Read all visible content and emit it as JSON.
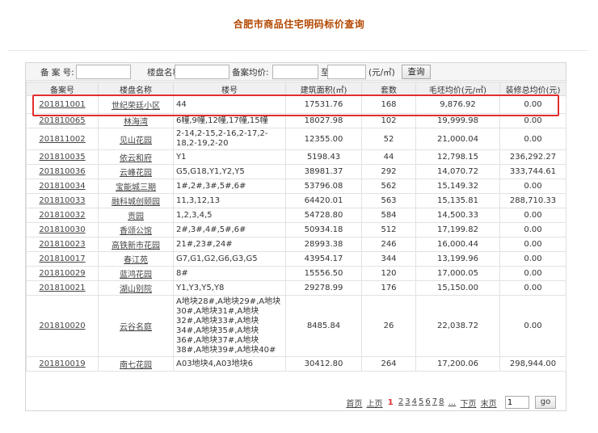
{
  "title": "合肥市商品住宅明码标价查询",
  "search": {
    "record_no_label": "备 案 号:",
    "project_name_label": "楼盘名称:",
    "avg_price_label": "备案均价:",
    "to_label": "至",
    "unit_label": "(元/㎡)",
    "button_label": "查询",
    "record_no_value": "",
    "project_name_value": "",
    "price_from_value": "",
    "price_to_value": ""
  },
  "table": {
    "headers": [
      "备案号",
      "楼盘名称",
      "楼号",
      "建筑面积(㎡)",
      "套数",
      "毛坯均价(元/㎡)",
      "装修总均价(元)"
    ],
    "rows": [
      {
        "code": "201811001",
        "name": "世纪荣廷小区",
        "buildings": "44",
        "area": "17531.76",
        "units": "168",
        "price": "9,876.92",
        "deco": "0.00"
      },
      {
        "code": "201810065",
        "name": "林海湾",
        "buildings": "6幢,9幢,12幢,17幢,15幢",
        "area": "18027.98",
        "units": "102",
        "price": "19,999.98",
        "deco": "0.00"
      },
      {
        "code": "201811002",
        "name": "见山花园",
        "buildings": "2-14,2-15,2-16,2-17,2-18,2-19,2-20",
        "area": "12355.00",
        "units": "52",
        "price": "21,000.04",
        "deco": "0.00"
      },
      {
        "code": "201810035",
        "name": "依云和府",
        "buildings": "Y1",
        "area": "5198.43",
        "units": "44",
        "price": "12,798.15",
        "deco": "236,292.27"
      },
      {
        "code": "201810036",
        "name": "云峰花园",
        "buildings": "G5,G18,Y1,Y2,Y5",
        "area": "38981.37",
        "units": "292",
        "price": "14,070.72",
        "deco": "333,744.61"
      },
      {
        "code": "201810034",
        "name": "宝能城三期",
        "buildings": "1#,2#,3#,5#,6#",
        "area": "53796.08",
        "units": "562",
        "price": "15,149.32",
        "deco": "0.00"
      },
      {
        "code": "201810033",
        "name": "融科城创颐园",
        "buildings": "11,3,12,13",
        "area": "64420.01",
        "units": "563",
        "price": "15,135.81",
        "deco": "288,710.33"
      },
      {
        "code": "201810032",
        "name": "贡园",
        "buildings": "1,2,3,4,5",
        "area": "54728.80",
        "units": "584",
        "price": "14,500.33",
        "deco": "0.00"
      },
      {
        "code": "201810030",
        "name": "香颂公馆",
        "buildings": "2#,3#,4#,5#,6#",
        "area": "50934.18",
        "units": "512",
        "price": "17,199.82",
        "deco": "0.00"
      },
      {
        "code": "201810023",
        "name": "高铁新市花园",
        "buildings": "21#,23#,24#",
        "area": "28993.38",
        "units": "246",
        "price": "16,000.44",
        "deco": "0.00"
      },
      {
        "code": "201810017",
        "name": "春江苑",
        "buildings": "G7,G1,G2,G6,G3,G5",
        "area": "43954.17",
        "units": "344",
        "price": "13,199.96",
        "deco": "0.00"
      },
      {
        "code": "201810029",
        "name": "蓝鸿花园",
        "buildings": "8#",
        "area": "15556.50",
        "units": "120",
        "price": "17,000.05",
        "deco": "0.00"
      },
      {
        "code": "201810021",
        "name": "湖山别院",
        "buildings": "Y1,Y3,Y5,Y8",
        "area": "29278.99",
        "units": "176",
        "price": "15,150.00",
        "deco": "0.00"
      },
      {
        "code": "201810020",
        "name": "云谷名庭",
        "buildings": "A地块28#,A地块29#,A地块30#,A地块31#,A地块32#,A地块33#,A地块34#,A地块35#,A地块36#,A地块37#,A地块38#,A地块39#,A地块40#",
        "area": "8485.84",
        "units": "26",
        "price": "22,038.72",
        "deco": "0.00"
      },
      {
        "code": "201810019",
        "name": "南七花园",
        "buildings": "A03地块4,A03地块6",
        "area": "30412.80",
        "units": "264",
        "price": "17,200.06",
        "deco": "298,944.00"
      }
    ]
  },
  "pager": {
    "first": "首页",
    "prev": "上页",
    "current": "1",
    "pages": [
      "2",
      "3",
      "4",
      "5",
      "6",
      "7",
      "8"
    ],
    "ellipsis": "...",
    "next": "下页",
    "last": "末页",
    "jump_value": "1",
    "go_label": "go"
  },
  "colors": {
    "title": "#b34700",
    "highlight": "#e32d2d",
    "header_bg": "#f0f0f0"
  }
}
